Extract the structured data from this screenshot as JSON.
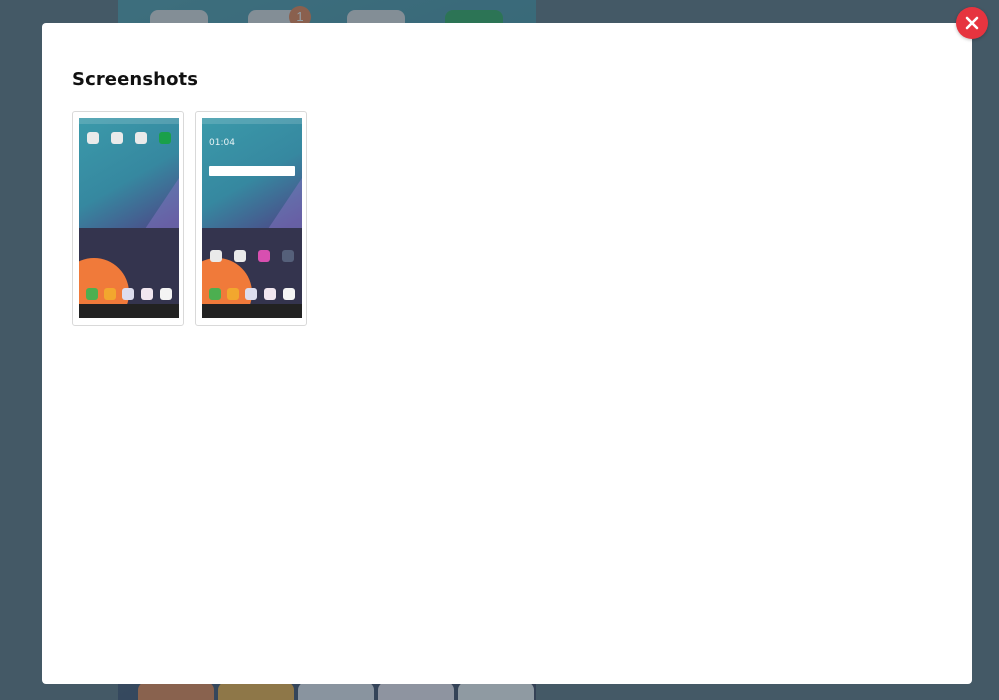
{
  "modal": {
    "title": "Screenshots"
  },
  "background": {
    "badge_count": "1"
  },
  "thumbnails": [
    {
      "name": "screenshot-1"
    },
    {
      "name": "screenshot-2",
      "clock_text": "01:04"
    }
  ],
  "colors": {
    "close_button": "#e6343f",
    "modal_bg": "#ffffff",
    "scrim": "#4f6470"
  },
  "icons": {
    "close": "close-icon"
  }
}
